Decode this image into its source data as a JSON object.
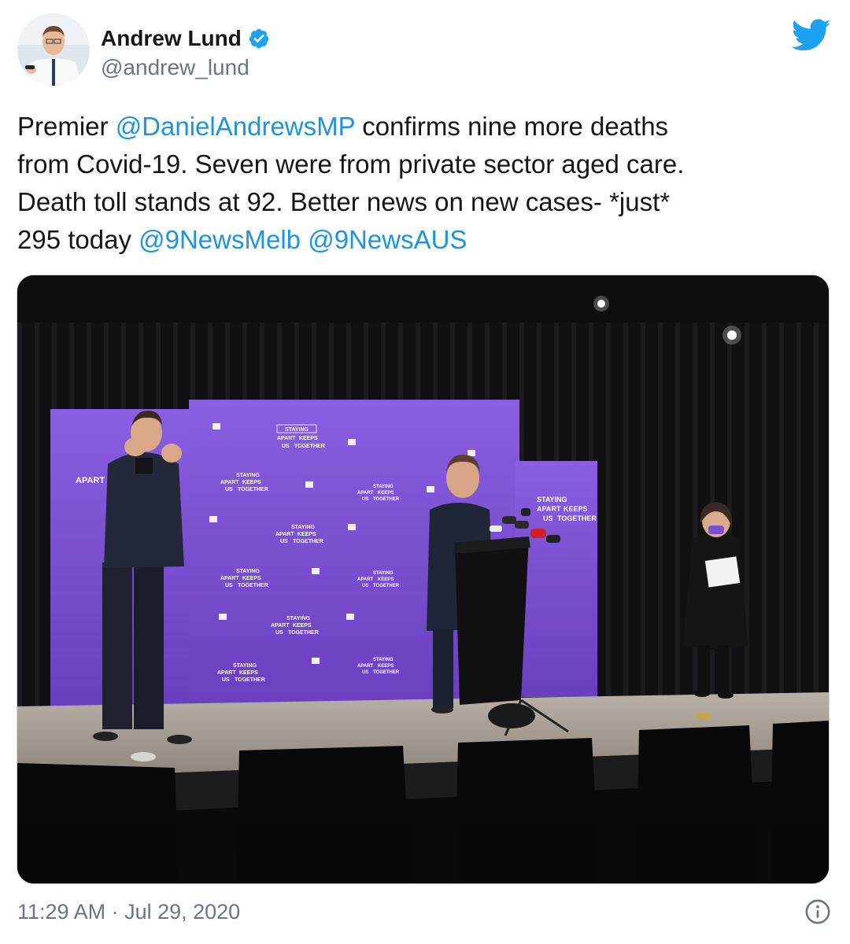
{
  "author": {
    "display_name": "Andrew Lund",
    "handle": "@andrew_lund",
    "verified": true
  },
  "tweet": {
    "segments": [
      {
        "text": "Premier ",
        "type": "text"
      },
      {
        "text": "@DanielAndrewsMP",
        "type": "mention"
      },
      {
        "text": " confirms nine more deaths\nfrom Covid-19. Seven were from private sector aged care.\nDeath toll stands at 92. Better news on new cases- *just*\n295 today ",
        "type": "text"
      },
      {
        "text": "@9NewsMelb",
        "type": "mention"
      },
      {
        "text": " ",
        "type": "text"
      },
      {
        "text": "@9NewsAUS",
        "type": "mention"
      }
    ]
  },
  "media": {
    "backdrop_text": {
      "line1": "STAYING",
      "line2": "APART",
      "line3": "KEEPS",
      "line4": "US",
      "line5": "TOGETHER"
    }
  },
  "footer": {
    "timestamp": "11:29 AM · Jul 29, 2020"
  },
  "icons": {
    "verified": "verified-badge-icon",
    "brand": "twitter-bird-icon",
    "info": "info-icon"
  },
  "colors": {
    "mention": "#1b95e0",
    "verified": "#1da1f2",
    "secondary_text": "#657786",
    "backdrop_purple": "#7b4fcf"
  }
}
